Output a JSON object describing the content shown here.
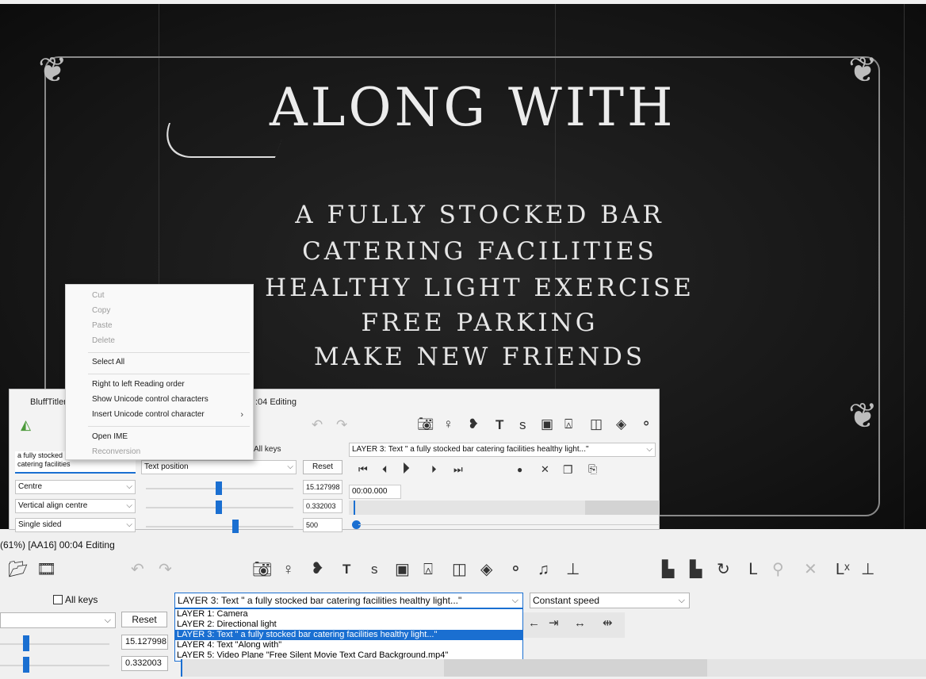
{
  "preview": {
    "title": "ALONG WITH",
    "lines": [
      "A FULLY STOCKED BAR",
      "CATERING FACILITIES",
      "HEALTHY LIGHT EXERCISE",
      "FREE PARKING",
      "MAKE NEW FRIENDS"
    ]
  },
  "inner_window": {
    "app_title": "BluffTitler",
    "status_title": ":04 Editing",
    "text_box_line1": "a fully stocked",
    "text_box_line2": "catering facilities",
    "all_keys_label": "All keys",
    "property_select": "Text position",
    "reset_label": "Reset",
    "align_select": "Centre",
    "valign_select": "Vertical align centre",
    "sided_select": "Single sided",
    "value1": "15.127998",
    "value2": "0.332003",
    "value3": "500",
    "layer_select": "LAYER 3: Text \" a fully stocked bar catering facilities healthy light...\"",
    "time": "00:00.000"
  },
  "context_menu": {
    "items": [
      "Cut",
      "Copy",
      "Paste",
      "Delete",
      "Select All",
      "Right to left Reading order",
      "Show Unicode control characters",
      "Insert Unicode control character",
      "Open IME",
      "Reconversion"
    ]
  },
  "main": {
    "title": "(61%) [AA16] 00:04 Editing",
    "all_keys_label": "All keys",
    "layer_select": "LAYER 3: Text \" a fully stocked bar catering facilities healthy light...\"",
    "speed_select": "Constant speed",
    "reset_label": "Reset",
    "value1": "15.127998",
    "value2": "0.332003",
    "layers": [
      "LAYER 1: Camera",
      "LAYER 2: Directional light",
      "LAYER 3: Text \" a fully stocked bar catering facilities healthy light...\"",
      "LAYER 4: Text \"Along with\"",
      "LAYER 5: Video Plane \"Free Silent Movie Text Card Background.mp4\""
    ]
  }
}
